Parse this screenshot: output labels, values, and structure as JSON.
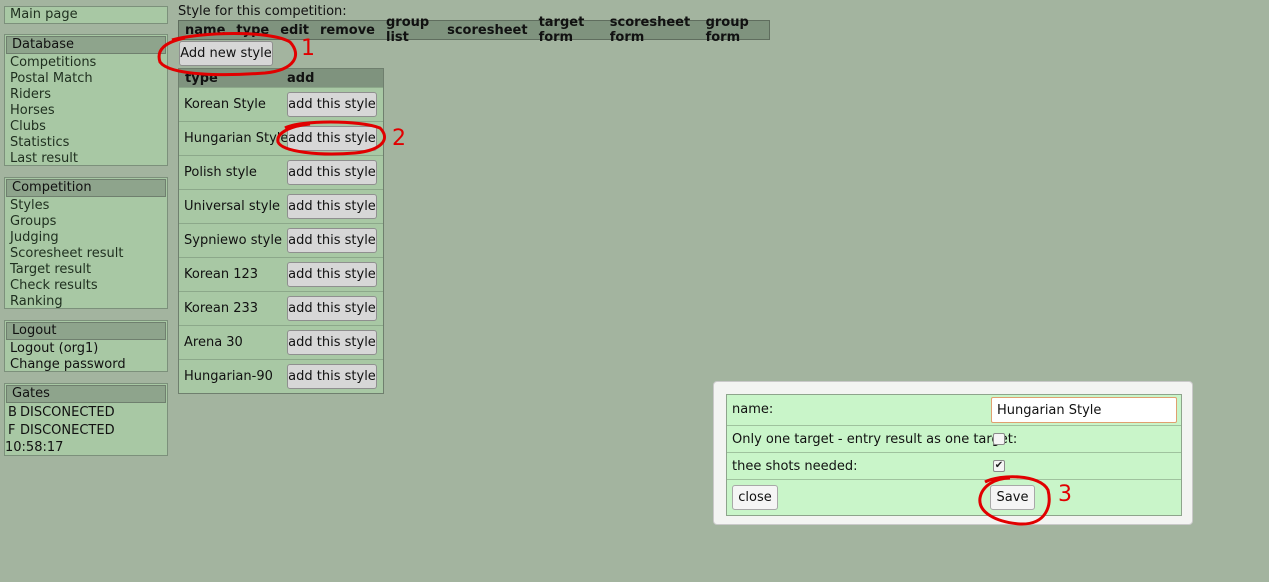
{
  "sidebar": {
    "main_page": "Main page",
    "database": {
      "title": "Database",
      "items": [
        "Competitions",
        "Postal Match",
        "Riders",
        "Horses",
        "Clubs",
        "Statistics",
        "Last result"
      ]
    },
    "competition": {
      "title": "Competition",
      "items": [
        "Styles",
        "Groups",
        "Judging",
        "Scoresheet result",
        "Target result",
        "Check results",
        "Ranking"
      ]
    },
    "logout": {
      "title": "Logout",
      "items": [
        "Logout (org1)",
        "Change password"
      ]
    },
    "gates": {
      "title": "Gates",
      "items": [
        {
          "gate": "B",
          "status": "DISCONECTED"
        },
        {
          "gate": "F",
          "status": "DISCONECTED"
        }
      ],
      "time": "10:58:17"
    }
  },
  "main": {
    "caption": "Style for this competition:",
    "columns": [
      "name",
      "type",
      "edit",
      "remove",
      "group list",
      "scoresheet",
      "target form",
      "scoresheet form",
      "group form"
    ],
    "add_new_label": "Add new style",
    "types_table": {
      "headers": [
        "type",
        "add"
      ],
      "button_label": "add this style",
      "rows": [
        "Korean Style",
        "Hungarian Style",
        "Polish style",
        "Universal style",
        "Sypniewo style",
        "Korean 123",
        "Korean 233",
        "Arena 30",
        "Hungarian-90"
      ]
    }
  },
  "dialog": {
    "name_label": "name:",
    "name_value": "Hungarian Style",
    "one_target_label": "Only one target - entry result as one target:",
    "one_target_checked": false,
    "three_shots_label": "thee shots needed:",
    "three_shots_checked": true,
    "close_label": "close",
    "save_label": "Save"
  },
  "annotations": {
    "color": "#e10000",
    "labels": [
      "1",
      "2",
      "3"
    ]
  }
}
